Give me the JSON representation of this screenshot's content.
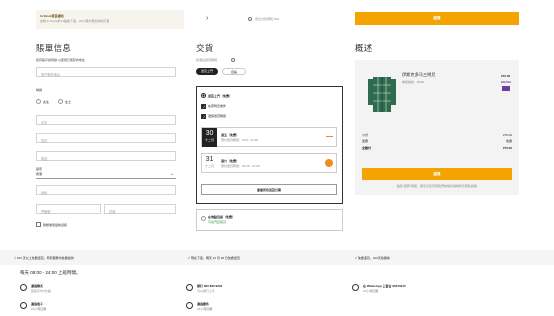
{
  "promo": {
    "title": "In Stock發貨通知",
    "subtitle": "在線 In Stock於12點前下單，24小時內發出你的訂單"
  },
  "secure": {
    "label": "安全付款通知 SSL"
  },
  "top_button": {
    "label": "結算"
  },
  "billing": {
    "heading": "賬單信息",
    "login_note": "如有賬戶請登錄 以使用已保存的地址",
    "email_placeholder": "電子郵件地址",
    "title_label": "稱謂",
    "title_options": [
      "先生",
      "女士"
    ],
    "first_name_placeholder": "名字",
    "last_name_placeholder": "姓氏",
    "phone_placeholder": "電話",
    "country_label": "國家",
    "country_value": "香港",
    "address_placeholder": "地址",
    "door_placeholder": "門牌號",
    "district_placeholder": "區域",
    "newsletter_label": "我想收到最新資訊"
  },
  "delivery": {
    "heading": "交貨",
    "note": "香港島送貨時間",
    "options": [
      "送貨上門",
      "自提"
    ],
    "home_label": "送貨上門（免費）",
    "check_1": "在家附近收件",
    "check_2": "選擇送貨時間",
    "day_1": {
      "num": "30",
      "month": "十二月",
      "title": "週五（免費）",
      "time": "預計送貨時間：9:00 - 21:00"
    },
    "day_2": {
      "num": "31",
      "month": "十二月",
      "title": "週六（免費）",
      "time": "預計送貨時間：09:00 - 21:00"
    },
    "more_button": "查看所有送貨日期",
    "pickup_label": "在地點自提（免費）",
    "pickup_sub": "可在門店取貨"
  },
  "summary": {
    "heading": "概述",
    "product_name": "伊斯克多马三明尼",
    "product_variant": "綠色格紋 · 38/40",
    "product_tag": "BRAVA",
    "subtotal_label": "小計",
    "subtotal_value": "270.00",
    "shipping_label": "運費",
    "shipping_value": "免費",
    "total_label": "全額付",
    "total_value": "270.00",
    "pay_button": "結算",
    "terms": "點擊\"結算\"按鈕，即表示您同意我們的條款與條件及隱私政策"
  },
  "guarantees": [
    "100 天以上免費退貨，所有服務均免費提供",
    "現在下單，明天 12 月 30 日免費送貨",
    "免費退貨，100天免費換"
  ],
  "contact": {
    "hours": "每天 08:00 - 24:00 上班時間。",
    "chat_title": "通過聊天",
    "chat_sub": "回答平均3分鐘",
    "email_title": "通過電子",
    "email_sub": "24小時回覆",
    "phone_title": "撥打 800 899 9233",
    "phone_sub": "可以撥打上午",
    "mail_title": "通過郵件",
    "mail_sub": "24小時回覆",
    "whatsapp_title": "在 WhatsApp 上留言 96370315",
    "whatsapp_sub": "24小時回覆"
  },
  "colors": {
    "accent": "#f4a300",
    "purple": "#6b3fa0",
    "orange": "#f08a24"
  }
}
